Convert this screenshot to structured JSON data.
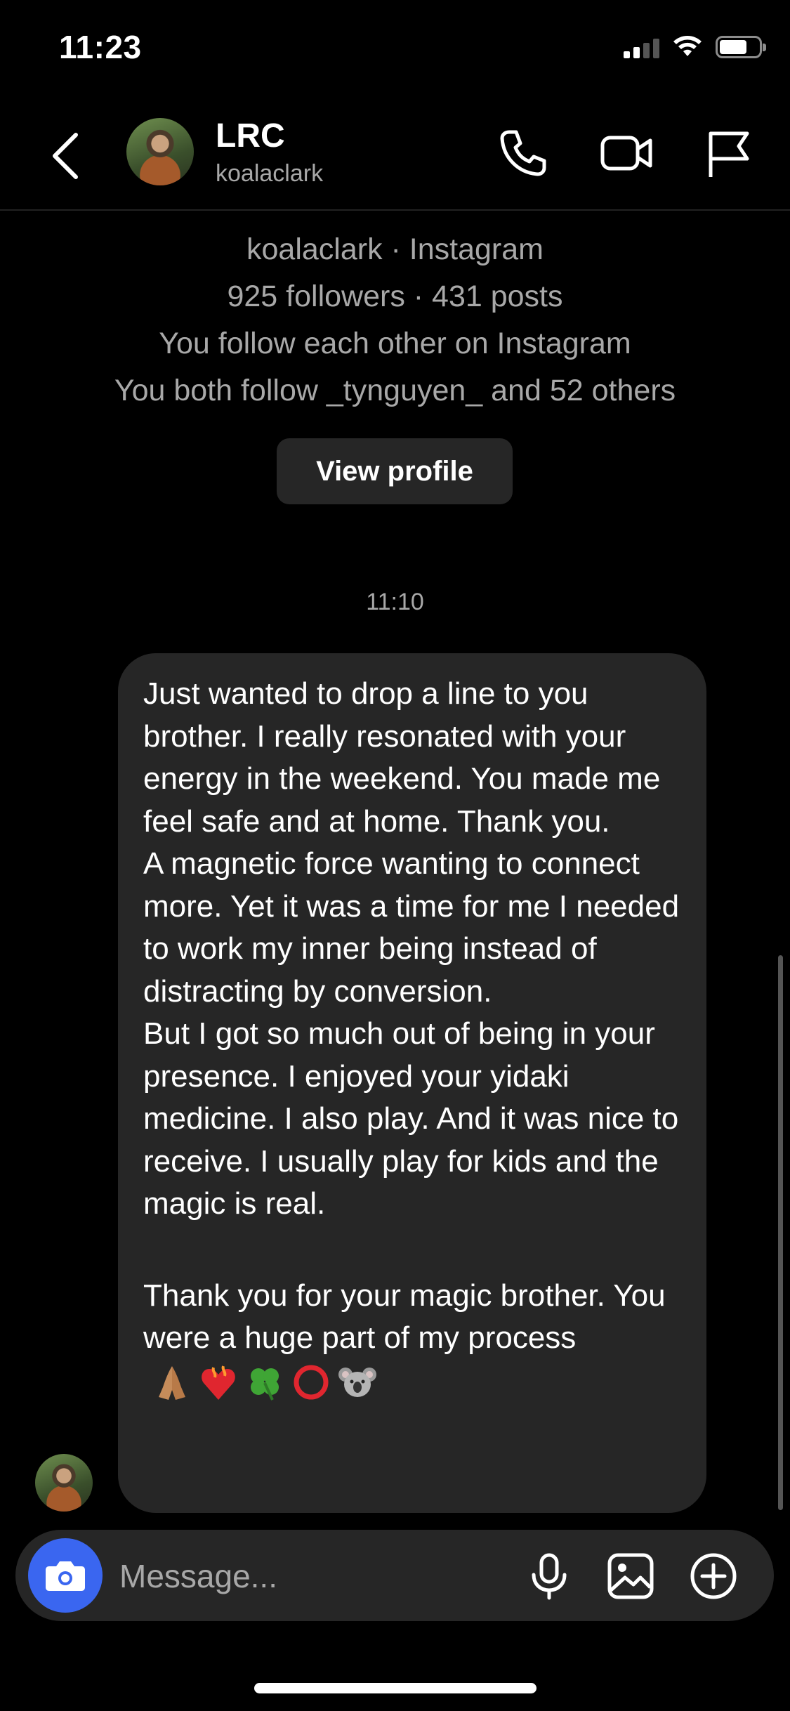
{
  "status_bar": {
    "time": "11:23"
  },
  "header": {
    "name": "LRC",
    "username": "koalaclark",
    "icons": [
      "back-chevron-icon",
      "phone-icon",
      "video-camera-icon",
      "flag-icon"
    ]
  },
  "profile": {
    "line1": "koalaclark · Instagram",
    "line2": "925 followers · 431 posts",
    "line3": "You follow each other on Instagram",
    "line4": "You both follow _tynguyen_ and 52 others",
    "view_profile_label": "View profile"
  },
  "thread": {
    "timestamp": "11:10",
    "message": {
      "para1": "Just wanted to drop a line to you brother. I really resonated with your energy in the weekend. You made me feel safe and at home. Thank you.",
      "para2": "A magnetic force wanting to connect more. Yet it was a time for me I needed to work my inner being instead of distracting by conversion.",
      "para3": "But I got so much out of being in your presence. I enjoyed your yidaki medicine. I also play. And it was nice to receive. I usually play for kids and the magic is real.",
      "para4": "Thank you for your magic brother. You were a huge part of my process",
      "emojis": [
        "praying-hands-emoji",
        "heart-on-fire-emoji",
        "four-leaf-clover-emoji",
        "red-circle-emoji",
        "koala-emoji"
      ]
    }
  },
  "composer": {
    "placeholder": "Message...",
    "icons": [
      "camera-icon",
      "microphone-icon",
      "gallery-icon",
      "plus-circle-icon"
    ]
  },
  "colors": {
    "background": "#000000",
    "bubble": "#262626",
    "secondary_text": "#a8a8a8",
    "camera_button": "#3a66f0"
  }
}
